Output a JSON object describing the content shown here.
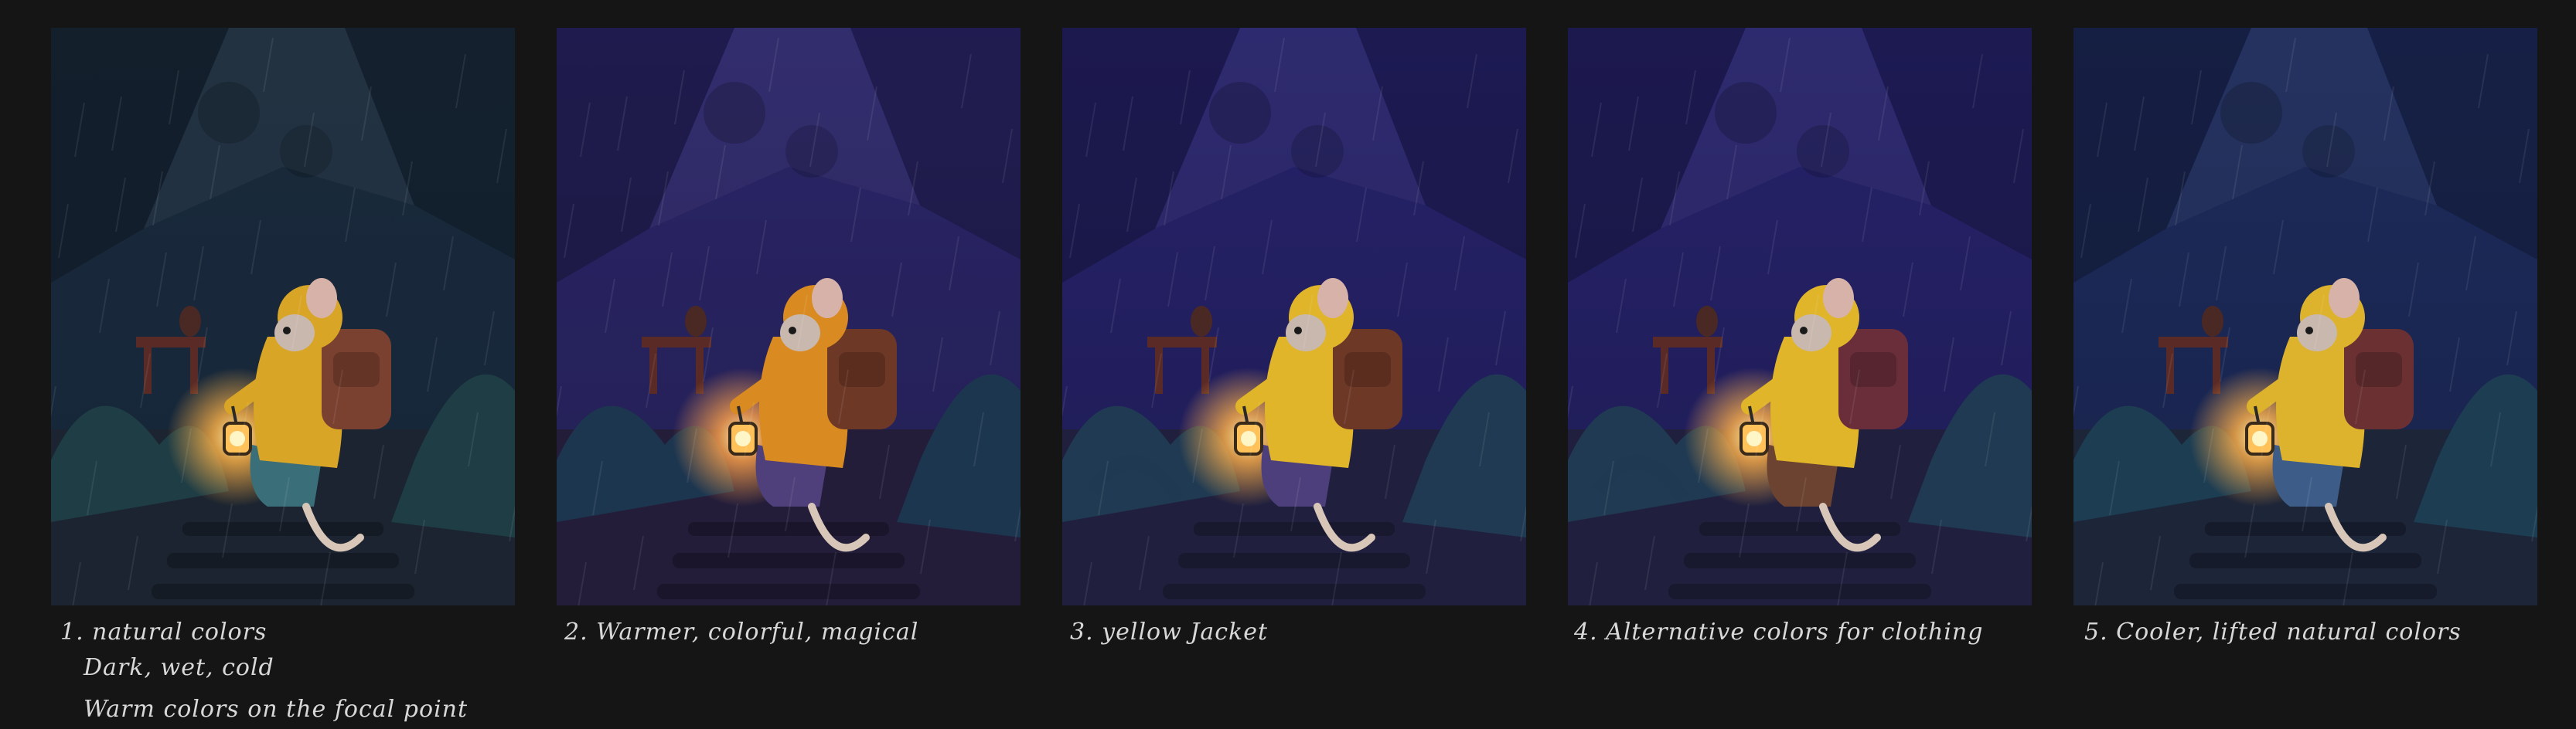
{
  "background": "#151515",
  "panels": [
    {
      "id": 1,
      "palette": {
        "sky": "#1a2a3a",
        "mid": "#15263a",
        "ground": "#1b2430",
        "jacket": "#d9a526",
        "pants": "#3a6e78",
        "pack": "#7a4030",
        "leaf": "#1f3d45",
        "glow": "#ffb347"
      },
      "caption": [
        "1. natural colors",
        "Dark, wet, cold",
        "Warm colors on the focal point"
      ]
    },
    {
      "id": 2,
      "palette": {
        "sky": "#2a2568",
        "mid": "#231f52",
        "ground": "#231d3a",
        "jacket": "#d98b22",
        "pants": "#4f3f7a",
        "pack": "#6e3826",
        "leaf": "#1d3650",
        "glow": "#ffa24a"
      },
      "caption": [
        "2. Warmer, colorful, magical"
      ]
    },
    {
      "id": 3,
      "palette": {
        "sky": "#26226a",
        "mid": "#1f1c55",
        "ground": "#20203e",
        "jacket": "#e0b52a",
        "pants": "#4c3f7c",
        "pack": "#6e3826",
        "leaf": "#1f3a52",
        "glow": "#ffb04a"
      },
      "caption": [
        "3. yellow Jacket"
      ]
    },
    {
      "id": 4,
      "palette": {
        "sky": "#26226a",
        "mid": "#1f1c55",
        "ground": "#20203e",
        "jacket": "#e0b52a",
        "pants": "#6b4330",
        "pack": "#6a2e3a",
        "leaf": "#1f3a52",
        "glow": "#ffb04a"
      },
      "caption": [
        "4. Alternative colors for clothing"
      ]
    },
    {
      "id": 5,
      "palette": {
        "sky": "#1d2a5a",
        "mid": "#18244c",
        "ground": "#1d2538",
        "jacket": "#ddb22c",
        "pants": "#3d5d88",
        "pack": "#6a3032",
        "leaf": "#1d3d52",
        "glow": "#ffb04a"
      },
      "caption": [
        "5. Cooler, lifted natural colors"
      ]
    }
  ]
}
